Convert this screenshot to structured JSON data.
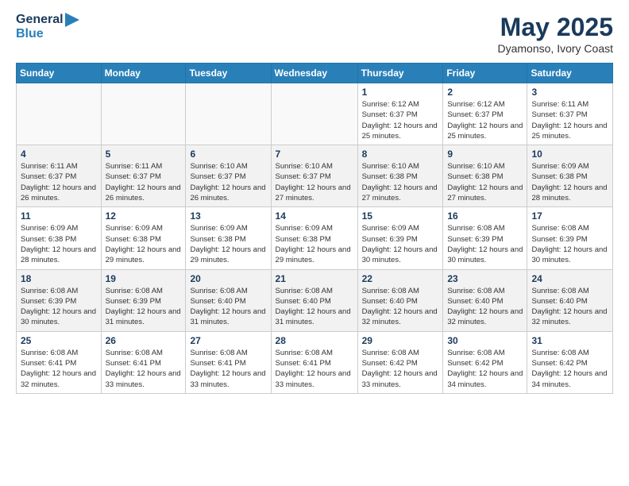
{
  "header": {
    "logo_line1": "General",
    "logo_line2": "Blue",
    "month_year": "May 2025",
    "location": "Dyamonso, Ivory Coast"
  },
  "days_of_week": [
    "Sunday",
    "Monday",
    "Tuesday",
    "Wednesday",
    "Thursday",
    "Friday",
    "Saturday"
  ],
  "weeks": [
    [
      {
        "day": "",
        "info": ""
      },
      {
        "day": "",
        "info": ""
      },
      {
        "day": "",
        "info": ""
      },
      {
        "day": "",
        "info": ""
      },
      {
        "day": "1",
        "info": "Sunrise: 6:12 AM\nSunset: 6:37 PM\nDaylight: 12 hours and 25 minutes."
      },
      {
        "day": "2",
        "info": "Sunrise: 6:12 AM\nSunset: 6:37 PM\nDaylight: 12 hours and 25 minutes."
      },
      {
        "day": "3",
        "info": "Sunrise: 6:11 AM\nSunset: 6:37 PM\nDaylight: 12 hours and 25 minutes."
      }
    ],
    [
      {
        "day": "4",
        "info": "Sunrise: 6:11 AM\nSunset: 6:37 PM\nDaylight: 12 hours and 26 minutes."
      },
      {
        "day": "5",
        "info": "Sunrise: 6:11 AM\nSunset: 6:37 PM\nDaylight: 12 hours and 26 minutes."
      },
      {
        "day": "6",
        "info": "Sunrise: 6:10 AM\nSunset: 6:37 PM\nDaylight: 12 hours and 26 minutes."
      },
      {
        "day": "7",
        "info": "Sunrise: 6:10 AM\nSunset: 6:37 PM\nDaylight: 12 hours and 27 minutes."
      },
      {
        "day": "8",
        "info": "Sunrise: 6:10 AM\nSunset: 6:38 PM\nDaylight: 12 hours and 27 minutes."
      },
      {
        "day": "9",
        "info": "Sunrise: 6:10 AM\nSunset: 6:38 PM\nDaylight: 12 hours and 27 minutes."
      },
      {
        "day": "10",
        "info": "Sunrise: 6:09 AM\nSunset: 6:38 PM\nDaylight: 12 hours and 28 minutes."
      }
    ],
    [
      {
        "day": "11",
        "info": "Sunrise: 6:09 AM\nSunset: 6:38 PM\nDaylight: 12 hours and 28 minutes."
      },
      {
        "day": "12",
        "info": "Sunrise: 6:09 AM\nSunset: 6:38 PM\nDaylight: 12 hours and 29 minutes."
      },
      {
        "day": "13",
        "info": "Sunrise: 6:09 AM\nSunset: 6:38 PM\nDaylight: 12 hours and 29 minutes."
      },
      {
        "day": "14",
        "info": "Sunrise: 6:09 AM\nSunset: 6:38 PM\nDaylight: 12 hours and 29 minutes."
      },
      {
        "day": "15",
        "info": "Sunrise: 6:09 AM\nSunset: 6:39 PM\nDaylight: 12 hours and 30 minutes."
      },
      {
        "day": "16",
        "info": "Sunrise: 6:08 AM\nSunset: 6:39 PM\nDaylight: 12 hours and 30 minutes."
      },
      {
        "day": "17",
        "info": "Sunrise: 6:08 AM\nSunset: 6:39 PM\nDaylight: 12 hours and 30 minutes."
      }
    ],
    [
      {
        "day": "18",
        "info": "Sunrise: 6:08 AM\nSunset: 6:39 PM\nDaylight: 12 hours and 30 minutes."
      },
      {
        "day": "19",
        "info": "Sunrise: 6:08 AM\nSunset: 6:39 PM\nDaylight: 12 hours and 31 minutes."
      },
      {
        "day": "20",
        "info": "Sunrise: 6:08 AM\nSunset: 6:40 PM\nDaylight: 12 hours and 31 minutes."
      },
      {
        "day": "21",
        "info": "Sunrise: 6:08 AM\nSunset: 6:40 PM\nDaylight: 12 hours and 31 minutes."
      },
      {
        "day": "22",
        "info": "Sunrise: 6:08 AM\nSunset: 6:40 PM\nDaylight: 12 hours and 32 minutes."
      },
      {
        "day": "23",
        "info": "Sunrise: 6:08 AM\nSunset: 6:40 PM\nDaylight: 12 hours and 32 minutes."
      },
      {
        "day": "24",
        "info": "Sunrise: 6:08 AM\nSunset: 6:40 PM\nDaylight: 12 hours and 32 minutes."
      }
    ],
    [
      {
        "day": "25",
        "info": "Sunrise: 6:08 AM\nSunset: 6:41 PM\nDaylight: 12 hours and 32 minutes."
      },
      {
        "day": "26",
        "info": "Sunrise: 6:08 AM\nSunset: 6:41 PM\nDaylight: 12 hours and 33 minutes."
      },
      {
        "day": "27",
        "info": "Sunrise: 6:08 AM\nSunset: 6:41 PM\nDaylight: 12 hours and 33 minutes."
      },
      {
        "day": "28",
        "info": "Sunrise: 6:08 AM\nSunset: 6:41 PM\nDaylight: 12 hours and 33 minutes."
      },
      {
        "day": "29",
        "info": "Sunrise: 6:08 AM\nSunset: 6:42 PM\nDaylight: 12 hours and 33 minutes."
      },
      {
        "day": "30",
        "info": "Sunrise: 6:08 AM\nSunset: 6:42 PM\nDaylight: 12 hours and 34 minutes."
      },
      {
        "day": "31",
        "info": "Sunrise: 6:08 AM\nSunset: 6:42 PM\nDaylight: 12 hours and 34 minutes."
      }
    ]
  ]
}
